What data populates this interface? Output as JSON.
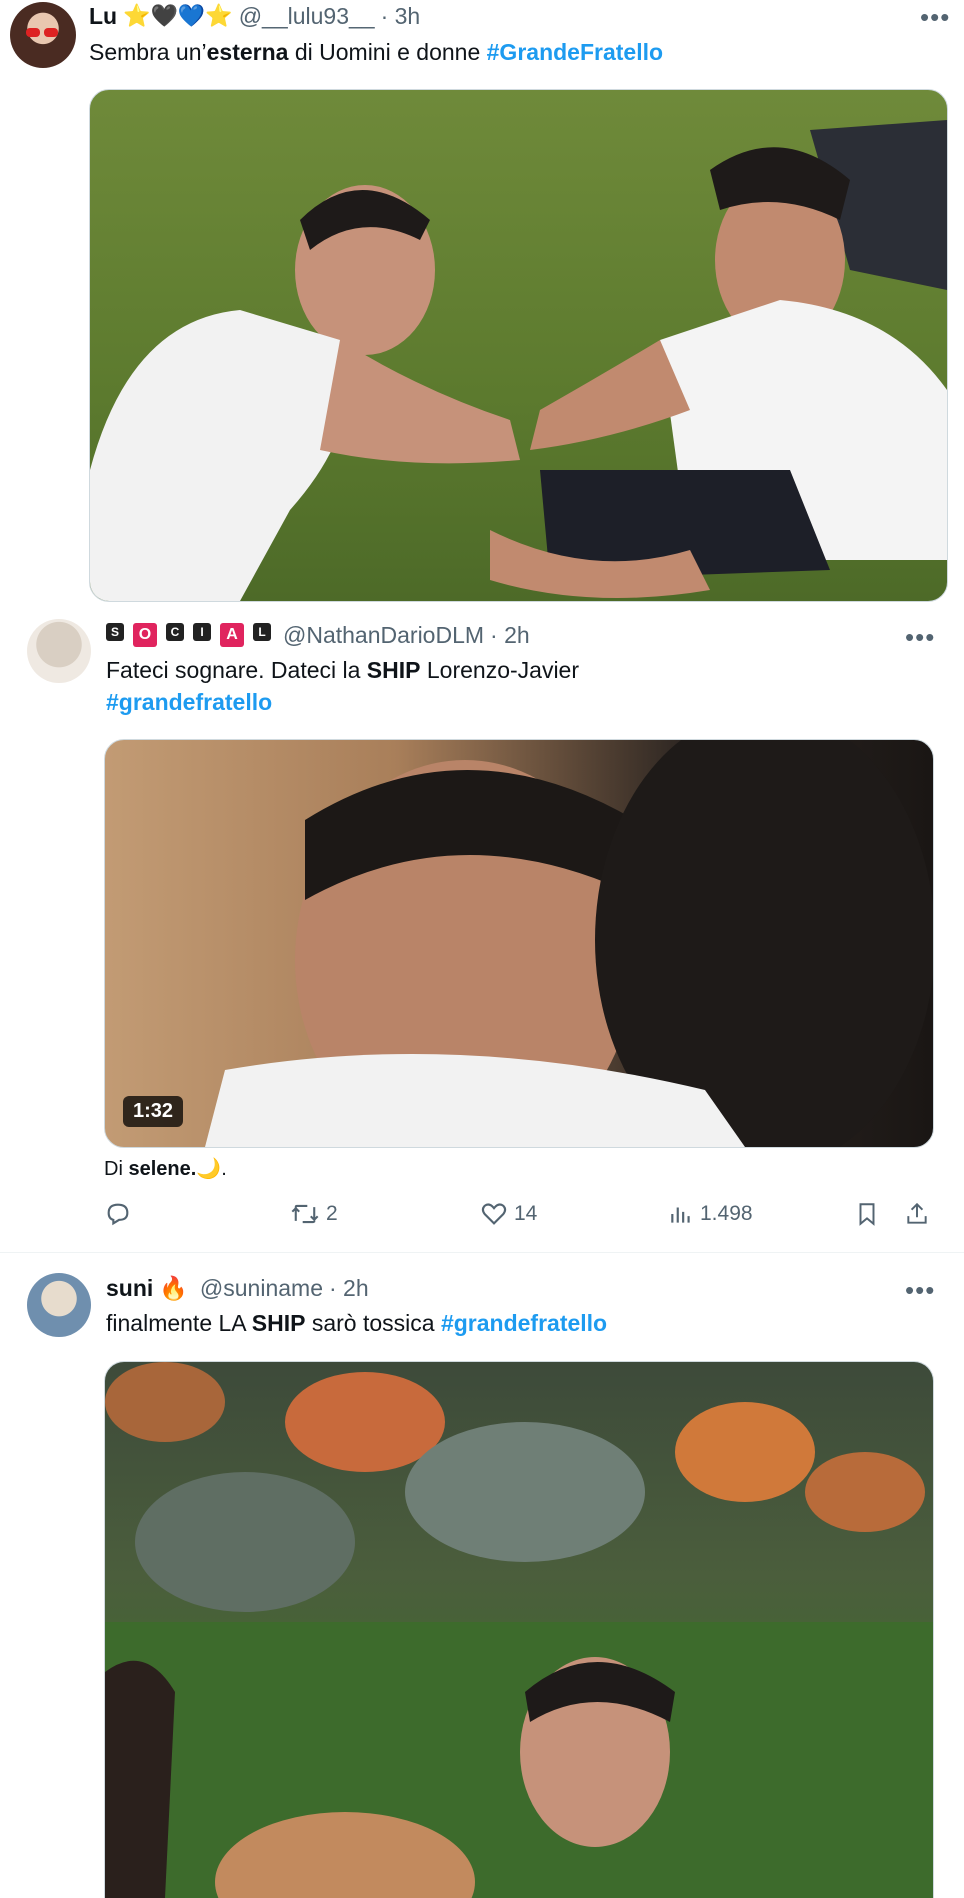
{
  "tweets": [
    {
      "name": "Lu",
      "emojis": "⭐🖤💙⭐",
      "handle": "@__lulu93__",
      "time": "· 3h",
      "text_parts": [
        "Sembra un’",
        "esterna",
        " di Uomini e donne  ",
        "#GrandeFratello"
      ]
    },
    {
      "badge_letters": [
        "S",
        "O",
        "C",
        "I",
        "A",
        "L"
      ],
      "handle": "@NathanDarioDLM",
      "time": "· 2h",
      "text_line1_parts": [
        "Fateci sognare. Dateci la ",
        "SHIP",
        " Lorenzo-Javier"
      ],
      "text_line2": "#grandefratello",
      "video_duration": "1:32",
      "caption_parts": [
        "Di ",
        "selene.",
        "🌙",
        "."
      ],
      "actions": {
        "reply": "",
        "retweet": "2",
        "like": "14",
        "views": "1.498"
      }
    },
    {
      "name": "suni",
      "emoji": "🔥",
      "handle": "@suniname",
      "time": "· 2h",
      "text_parts": [
        "finalmente LA ",
        "SHIP",
        " sarò tossica ",
        "#grandefratello"
      ]
    }
  ],
  "more_label": "•••",
  "colors": {
    "link": "#1d9bf0",
    "muted": "#536471",
    "text": "#0f1419"
  }
}
